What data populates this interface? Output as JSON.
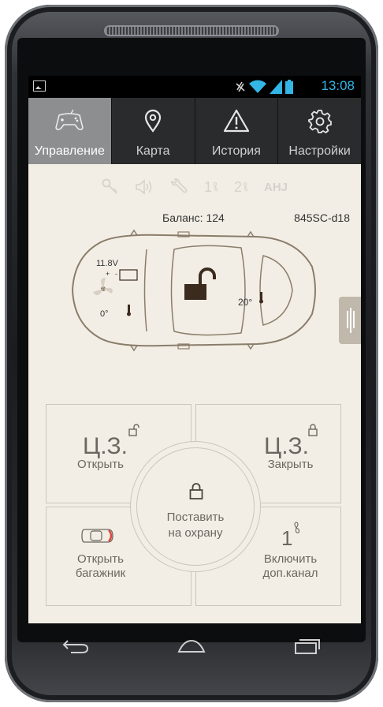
{
  "status_bar": {
    "time": "13:08"
  },
  "tabs": [
    {
      "label": "Управление",
      "icon": "gamepad-icon",
      "active": true
    },
    {
      "label": "Карта",
      "icon": "map-pin-icon",
      "active": false
    },
    {
      "label": "История",
      "icon": "warning-icon",
      "active": false
    },
    {
      "label": "Настройки",
      "icon": "gear-icon",
      "active": false
    }
  ],
  "status_icons": {
    "channel1": "1",
    "channel2": "2",
    "ahj": "AHJ"
  },
  "info": {
    "balance": "Баланс: 124",
    "device_id": "845SC-d18"
  },
  "car": {
    "voltage": "11.8V",
    "engine_temp": "0°",
    "cabin_temp": "20°",
    "battery_plus": "+",
    "battery_minus": "-"
  },
  "controls": {
    "lock_open": {
      "abbr": "Ц.З.",
      "label": "Открыть"
    },
    "lock_close": {
      "abbr": "Ц.З.",
      "label": "Закрыть"
    },
    "trunk": {
      "line1": "Открыть",
      "line2": "багажник"
    },
    "channel": {
      "number": "1",
      "line1": "Включить",
      "line2": "доп.канал"
    },
    "arm": {
      "line1": "Поставить",
      "line2": "на охрану"
    }
  },
  "colors": {
    "accent": "#33b5e5",
    "background": "#f3eee5",
    "lock_icon": "#3b2a1e",
    "trunk_red": "#e0443c"
  }
}
